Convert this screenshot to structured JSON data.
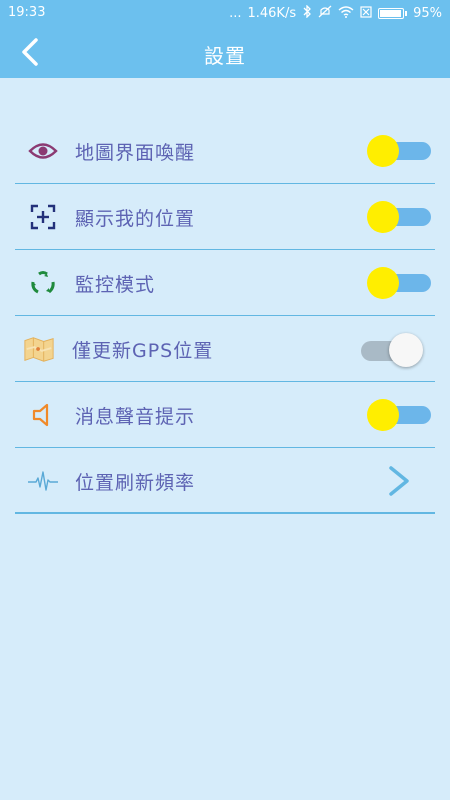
{
  "status_bar": {
    "time": "19:33",
    "net_speed": "1.46K/s",
    "battery": "95%",
    "dots": "..."
  },
  "header": {
    "title": "設置",
    "back_icon": "chevron-left-icon"
  },
  "settings": [
    {
      "label": "地圖界面喚醒",
      "icon": "eye-icon",
      "control": "toggle",
      "on": true
    },
    {
      "label": "顯示我的位置",
      "icon": "locate-icon",
      "control": "toggle",
      "on": true
    },
    {
      "label": "監控模式",
      "icon": "recycle-icon",
      "control": "toggle",
      "on": true
    },
    {
      "label": "僅更新GPS位置",
      "icon": "map-icon",
      "control": "toggle",
      "on": false
    },
    {
      "label": "消息聲音提示",
      "icon": "speaker-icon",
      "control": "toggle",
      "on": true
    },
    {
      "label": "位置刷新頻率",
      "icon": "pulse-icon",
      "control": "chevron"
    }
  ],
  "colors": {
    "background": "#d6ecfa",
    "header": "#6cc0ee",
    "label": "#5d63b3",
    "divider": "#62b7e2",
    "toggle_thumb_on": "#ffee00",
    "toggle_track_on": "#6cb6ea",
    "toggle_track_off": "#a9bac6"
  }
}
